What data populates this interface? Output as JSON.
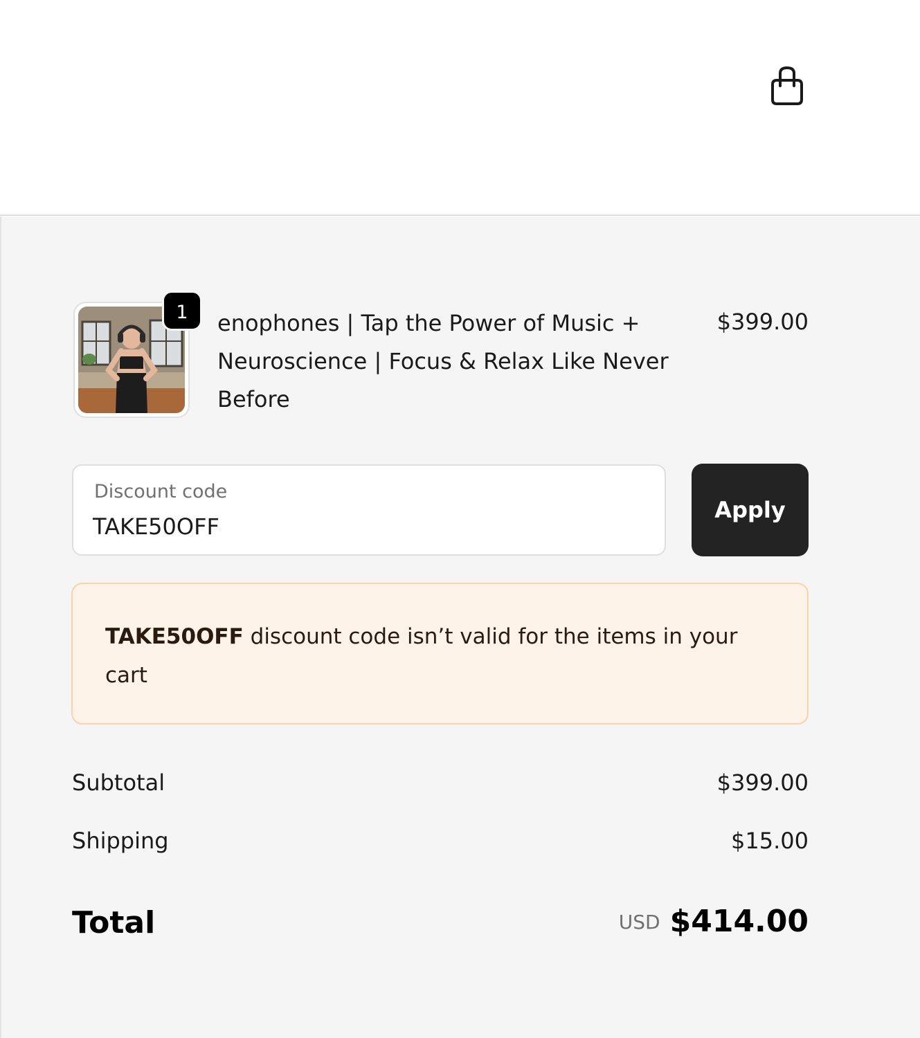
{
  "header": {
    "cart_icon": "shopping-bag-icon"
  },
  "line_item": {
    "quantity": "1",
    "title": "enophones | Tap the Power of Music + Neuroscience | Focus & Relax Like Never Before",
    "price": "$399.00",
    "image_icon": "product-photo-woman-with-headphones"
  },
  "discount": {
    "label": "Discount code",
    "value": "TAKE50OFF",
    "apply_label": "Apply"
  },
  "error": {
    "code": "TAKE50OFF",
    "message": " discount code isn’t valid for the items in your cart"
  },
  "totals": {
    "subtotal_label": "Subtotal",
    "subtotal_value": "$399.00",
    "shipping_label": "Shipping",
    "shipping_value": "$15.00",
    "total_label": "Total",
    "currency": "USD",
    "total_value": "$414.00"
  },
  "colors": {
    "summary_bg": "#f5f5f5",
    "button_bg": "#232323",
    "error_bg": "#fdf3e9",
    "error_border": "#f8d2a9"
  }
}
